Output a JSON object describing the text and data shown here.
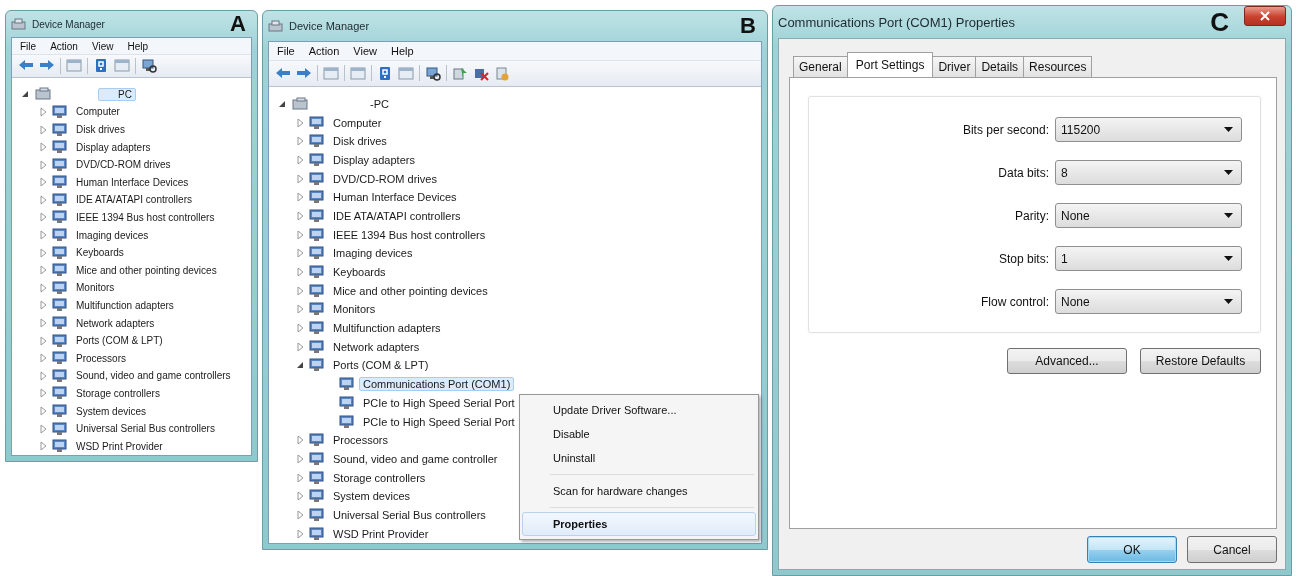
{
  "device_manager_windows": [
    {
      "panel_label": "A",
      "title": "Device Manager",
      "menu": [
        "File",
        "Action",
        "View",
        "Help"
      ],
      "tree": {
        "label": "PC",
        "expanded": true,
        "selected": true,
        "children": [
          {
            "label": "Computer",
            "expanded": false,
            "selected": false
          },
          {
            "label": "Disk drives",
            "expanded": false,
            "selected": false
          },
          {
            "label": "Display adapters",
            "expanded": false,
            "selected": false
          },
          {
            "label": "DVD/CD-ROM drives",
            "expanded": false,
            "selected": false
          },
          {
            "label": "Human Interface Devices",
            "expanded": false,
            "selected": false
          },
          {
            "label": "IDE ATA/ATAPI controllers",
            "expanded": false,
            "selected": false
          },
          {
            "label": "IEEE 1394 Bus host controllers",
            "expanded": false,
            "selected": false
          },
          {
            "label": "Imaging devices",
            "expanded": false,
            "selected": false
          },
          {
            "label": "Keyboards",
            "expanded": false,
            "selected": false
          },
          {
            "label": "Mice and other pointing devices",
            "expanded": false,
            "selected": false
          },
          {
            "label": "Monitors",
            "expanded": false,
            "selected": false
          },
          {
            "label": "Multifunction adapters",
            "expanded": false,
            "selected": false
          },
          {
            "label": "Network adapters",
            "expanded": false,
            "selected": false
          },
          {
            "label": "Ports (COM & LPT)",
            "expanded": false,
            "selected": false
          },
          {
            "label": "Processors",
            "expanded": false,
            "selected": false
          },
          {
            "label": "Sound, video and game controllers",
            "expanded": false,
            "selected": false
          },
          {
            "label": "Storage controllers",
            "expanded": false,
            "selected": false
          },
          {
            "label": "System devices",
            "expanded": false,
            "selected": false
          },
          {
            "label": "Universal Serial Bus controllers",
            "expanded": false,
            "selected": false
          },
          {
            "label": "WSD Print Provider",
            "expanded": false,
            "selected": false
          }
        ]
      }
    },
    {
      "panel_label": "B",
      "title": "Device Manager",
      "menu": [
        "File",
        "Action",
        "View",
        "Help"
      ],
      "tree": {
        "label": "-PC",
        "expanded": true,
        "selected": false,
        "children": [
          {
            "label": "Computer",
            "expanded": false,
            "selected": false
          },
          {
            "label": "Disk drives",
            "expanded": false,
            "selected": false
          },
          {
            "label": "Display adapters",
            "expanded": false,
            "selected": false
          },
          {
            "label": "DVD/CD-ROM drives",
            "expanded": false,
            "selected": false
          },
          {
            "label": "Human Interface Devices",
            "expanded": false,
            "selected": false
          },
          {
            "label": "IDE ATA/ATAPI controllers",
            "expanded": false,
            "selected": false
          },
          {
            "label": "IEEE 1394 Bus host controllers",
            "expanded": false,
            "selected": false
          },
          {
            "label": "Imaging devices",
            "expanded": false,
            "selected": false
          },
          {
            "label": "Keyboards",
            "expanded": false,
            "selected": false
          },
          {
            "label": "Mice and other pointing devices",
            "expanded": false,
            "selected": false
          },
          {
            "label": "Monitors",
            "expanded": false,
            "selected": false
          },
          {
            "label": "Multifunction adapters",
            "expanded": false,
            "selected": false
          },
          {
            "label": "Network adapters",
            "expanded": false,
            "selected": false
          },
          {
            "label": "Ports (COM & LPT)",
            "expanded": true,
            "selected": false,
            "children": [
              {
                "label": "Communications Port (COM1)",
                "selected": true
              },
              {
                "label": "PCIe to High Speed Serial Port",
                "selected": false
              },
              {
                "label": "PCIe to High Speed Serial Port",
                "selected": false
              }
            ]
          },
          {
            "label": "Processors",
            "expanded": false,
            "selected": false
          },
          {
            "label": "Sound, video and game controller",
            "expanded": false,
            "selected": false
          },
          {
            "label": "Storage controllers",
            "expanded": false,
            "selected": false
          },
          {
            "label": "System devices",
            "expanded": false,
            "selected": false
          },
          {
            "label": "Universal Serial Bus controllers",
            "expanded": false,
            "selected": false
          },
          {
            "label": "WSD Print Provider",
            "expanded": false,
            "selected": false
          }
        ]
      },
      "context_menu": [
        {
          "kind": "item",
          "label": "Update Driver Software...",
          "default": false,
          "selected": false
        },
        {
          "kind": "item",
          "label": "Disable",
          "default": false,
          "selected": false
        },
        {
          "kind": "item",
          "label": "Uninstall",
          "default": false,
          "selected": false
        },
        {
          "kind": "separator"
        },
        {
          "kind": "item",
          "label": "Scan for hardware changes",
          "default": false,
          "selected": false
        },
        {
          "kind": "separator"
        },
        {
          "kind": "item",
          "label": "Properties",
          "default": true,
          "selected": true
        }
      ]
    }
  ],
  "properties_dialog": {
    "panel_label": "C",
    "title": "Communications Port (COM1) Properties",
    "tabs": [
      {
        "label": "General",
        "selected": false
      },
      {
        "label": "Port Settings",
        "selected": true
      },
      {
        "label": "Driver",
        "selected": false
      },
      {
        "label": "Details",
        "selected": false
      },
      {
        "label": "Resources",
        "selected": false
      }
    ],
    "settings": [
      {
        "label": "Bits per second:",
        "value": "115200"
      },
      {
        "label": "Data bits:",
        "value": "8"
      },
      {
        "label": "Parity:",
        "value": "None"
      },
      {
        "label": "Stop bits:",
        "value": "1"
      },
      {
        "label": "Flow control:",
        "value": "None"
      }
    ],
    "buttons": [
      {
        "label": "Advanced..."
      },
      {
        "label": "Restore Defaults"
      }
    ],
    "footer_buttons": [
      {
        "label": "OK",
        "default": true
      },
      {
        "label": "Cancel",
        "default": false
      }
    ]
  }
}
